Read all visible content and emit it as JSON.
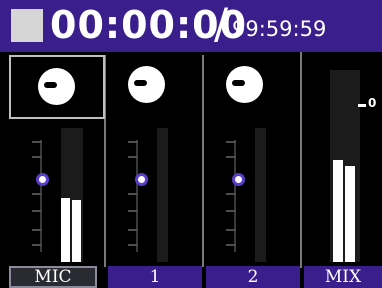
{
  "topbar": {
    "timecode": "00:00:00",
    "separator": "/",
    "max_time": "99:59:59"
  },
  "channels": [
    {
      "label": "MIC",
      "selected": true
    },
    {
      "label": "1",
      "selected": false
    },
    {
      "label": "2",
      "selected": false
    }
  ],
  "mix": {
    "label": "MIX",
    "zero_label": "0"
  },
  "colors": {
    "accent": "#3a1f8c",
    "fader_ring": "#5a3dc8",
    "background": "#000000"
  },
  "icons": {
    "stop": "stop-icon",
    "knob": "pan-knob-icon"
  }
}
